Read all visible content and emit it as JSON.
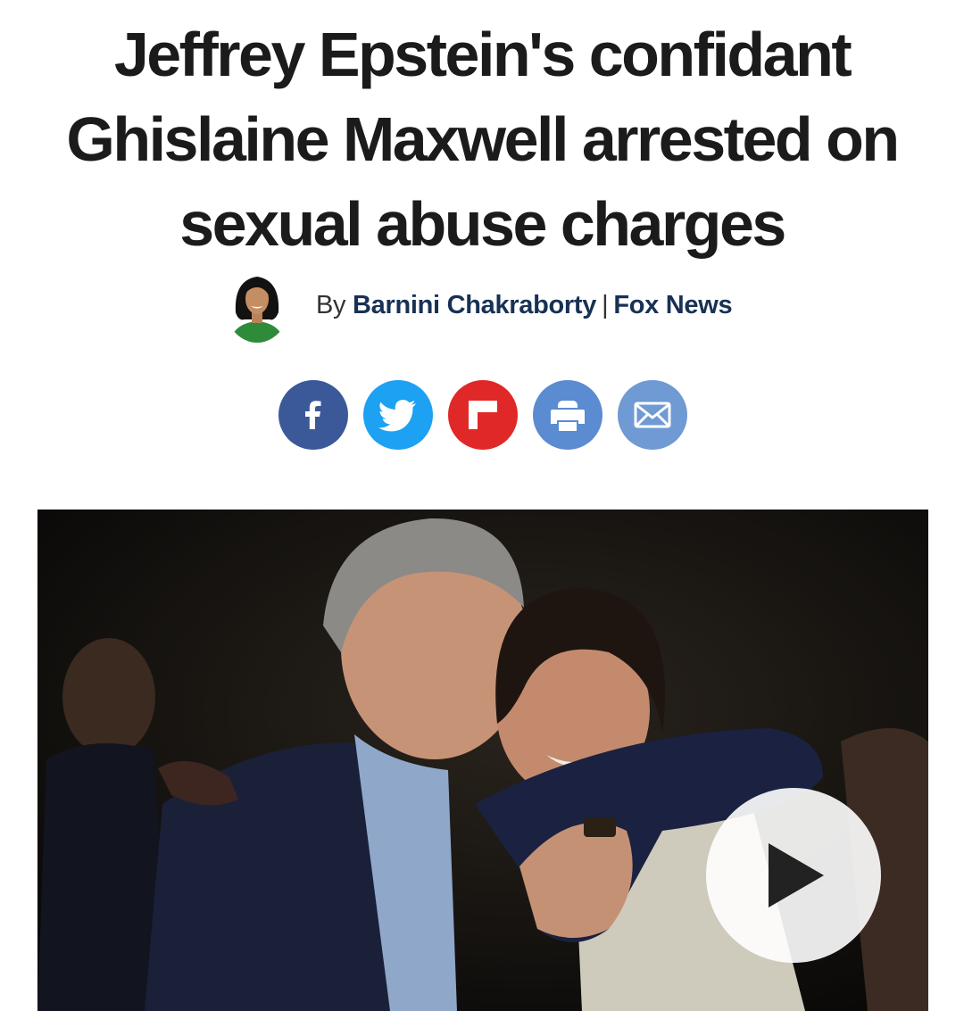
{
  "article": {
    "headline_line1": "Jeffrey Epstein's confidant",
    "headline_line2": "Ghislaine Maxwell arrested on",
    "headline_line3": "sexual abuse charges"
  },
  "byline": {
    "prefix": "By",
    "author": "Barnini Chakraborty",
    "separator": "|",
    "source": "Fox News"
  },
  "share": [
    {
      "network": "facebook",
      "icon": "facebook-icon",
      "color": "#3b5998"
    },
    {
      "network": "twitter",
      "icon": "twitter-icon",
      "color": "#1da1f2"
    },
    {
      "network": "flipboard",
      "icon": "flipboard-icon",
      "color": "#e12828"
    },
    {
      "network": "print",
      "icon": "print-icon",
      "color": "#5b8bd0"
    },
    {
      "network": "email",
      "icon": "email-icon",
      "color": "#6f9ad3"
    }
  ],
  "hero": {
    "play_icon": "play-icon"
  }
}
